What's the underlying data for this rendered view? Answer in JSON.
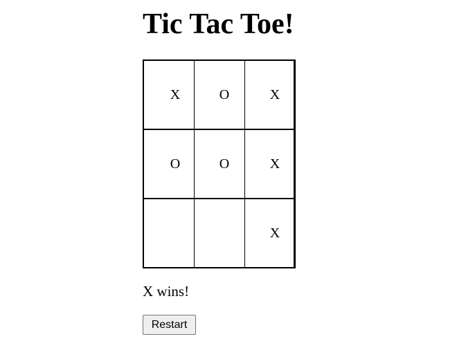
{
  "title": "Tic Tac Toe!",
  "board": [
    [
      "X",
      "O",
      "X"
    ],
    [
      "O",
      "O",
      "X"
    ],
    [
      "",
      "",
      "X"
    ]
  ],
  "status": "X wins!",
  "restart_label": "Restart"
}
